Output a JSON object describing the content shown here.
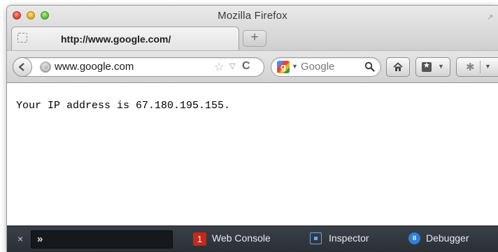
{
  "window": {
    "title": "Mozilla Firefox"
  },
  "tab": {
    "label": "http://www.google.com/"
  },
  "navbar": {
    "url": "www.google.com",
    "search_engine": "Google"
  },
  "content": {
    "text": "Your IP address is 67.180.195.155."
  },
  "devtools": {
    "console_label": "Web Console",
    "console_error_count": "1",
    "inspector_label": "Inspector",
    "debugger_label": "Debugger",
    "close_glyph": "×",
    "prompt_glyph": "»"
  },
  "colors": {
    "error_badge": "#c8281c",
    "devbar_bg": "#2f343b",
    "accent_blue": "#2f7fd8"
  },
  "icons": [
    "close-window-icon",
    "minimize-window-icon",
    "zoom-window-icon",
    "fullscreen-icon",
    "placeholder-favicon-icon",
    "plus-icon",
    "back-arrow-icon",
    "site-identity-icon",
    "star-icon",
    "dropdown-arrow-icon",
    "reload-icon",
    "google-icon",
    "search-icon",
    "home-icon",
    "bookmarks-icon",
    "addon-icon",
    "close-icon",
    "chevron-right-icon",
    "error-badge-icon",
    "inspector-icon",
    "debugger-icon"
  ]
}
